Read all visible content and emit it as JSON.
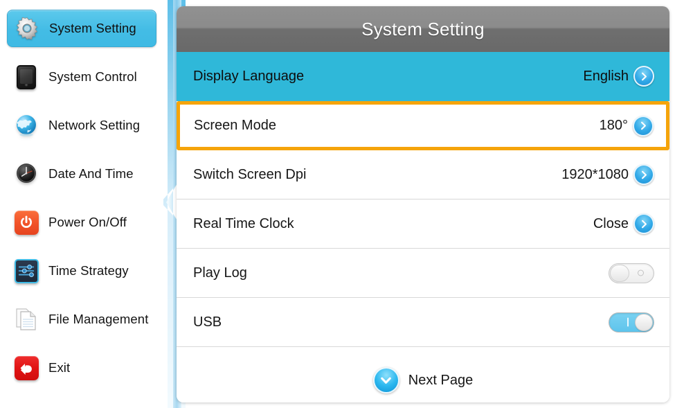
{
  "sidebar": {
    "items": [
      {
        "label": "System Setting",
        "icon": "gear-icon",
        "active": true
      },
      {
        "label": "System Control",
        "icon": "tablet-icon",
        "active": false
      },
      {
        "label": "Network Setting",
        "icon": "globe-icon",
        "active": false
      },
      {
        "label": "Date And Time",
        "icon": "clock-icon",
        "active": false
      },
      {
        "label": "Power On/Off",
        "icon": "power-icon",
        "active": false
      },
      {
        "label": "Time Strategy",
        "icon": "sliders-icon",
        "active": false
      },
      {
        "label": "File Management",
        "icon": "documents-icon",
        "active": false
      },
      {
        "label": "Exit",
        "icon": "back-arrow-icon",
        "active": false
      }
    ]
  },
  "panel": {
    "title": "System Setting",
    "rows": [
      {
        "label": "Display Language",
        "value": "English",
        "control": "chevron",
        "highlight": "accent"
      },
      {
        "label": "Screen Mode",
        "value": "180°",
        "control": "chevron",
        "highlight": "selected"
      },
      {
        "label": "Switch Screen Dpi",
        "value": "1920*1080",
        "control": "chevron",
        "highlight": "none"
      },
      {
        "label": "Real Time Clock",
        "value": "Close",
        "control": "chevron",
        "highlight": "none"
      },
      {
        "label": "Play Log",
        "value": "",
        "control": "toggle-off",
        "highlight": "none"
      },
      {
        "label": "USB",
        "value": "",
        "control": "toggle-on",
        "highlight": "none"
      }
    ],
    "footer": {
      "next_label": "Next Page",
      "next_icon": "chevron-down-icon"
    }
  },
  "colors": {
    "accent_row": "#2fb8d9",
    "selection_border": "#f5a40a",
    "sidebar_active": "#43bce5",
    "header_gray_top": "#919191",
    "header_gray_bottom": "#696969",
    "toggle_on": "#5ec4ec",
    "power_icon": "#f2542a",
    "exit_icon": "#e01414"
  }
}
